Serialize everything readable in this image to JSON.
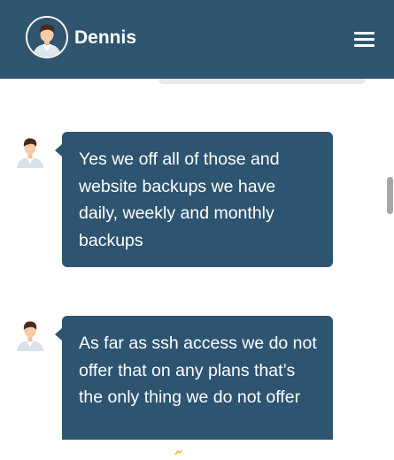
{
  "header": {
    "contact_name": "Dennis",
    "background_color": "#2f5571",
    "avatar_icon": "person-avatar-icon",
    "menu_icon": "hamburger-menu-icon"
  },
  "messages": [
    {
      "sender": "agent",
      "avatar_icon": "person-avatar-icon",
      "text": "Yes we off all of those and website backups we have daily, weekly and monthly backups"
    },
    {
      "sender": "agent",
      "avatar_icon": "person-avatar-icon",
      "text": "As far as ssh access we do not offer that on any plans that’s the only thing we do not offer"
    }
  ],
  "colors": {
    "bubble": "#2d5470",
    "bubble_text": "#ffffff",
    "previous_bubble": "#e7e8ea",
    "scrollbar": "#a7a7a7"
  }
}
